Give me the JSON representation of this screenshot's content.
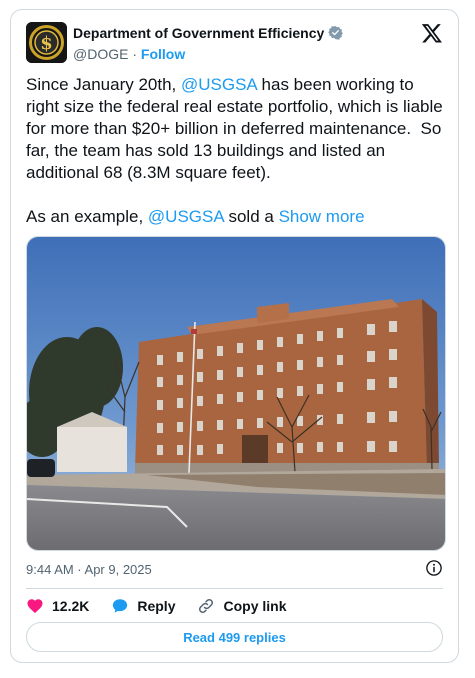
{
  "author": {
    "name": "Department of Government Efficiency",
    "handle": "@DOGE",
    "separator": " · ",
    "follow_label": "Follow"
  },
  "tweet": {
    "text_1": "Since January 20th, ",
    "mention_1": "@USGSA",
    "text_2": " has been working to right size the federal real estate portfolio, which is liable for more than $20+ billion in deferred maintenance.  So far, the team has sold 13 buildings and listed an additional 68 (8.3M square feet).\n\nAs an example, ",
    "mention_2": "@USGSA",
    "text_3": " sold a ",
    "show_more": "Show more"
  },
  "meta": {
    "timestamp": "9:44 AM · Apr 9, 2025"
  },
  "actions": {
    "likes": "12.2K",
    "reply_label": "Reply",
    "copy_link_label": "Copy link"
  },
  "read_replies_label": "Read 499 replies",
  "colors": {
    "accent": "#1d9bf0",
    "like": "#f91880",
    "text": "#0f1419",
    "muted": "#536471",
    "border": "#cfd9de"
  },
  "icons": [
    "doge-logo-icon",
    "verified-badge-icon",
    "x-logo-icon",
    "info-icon",
    "heart-icon",
    "reply-icon",
    "link-icon"
  ]
}
